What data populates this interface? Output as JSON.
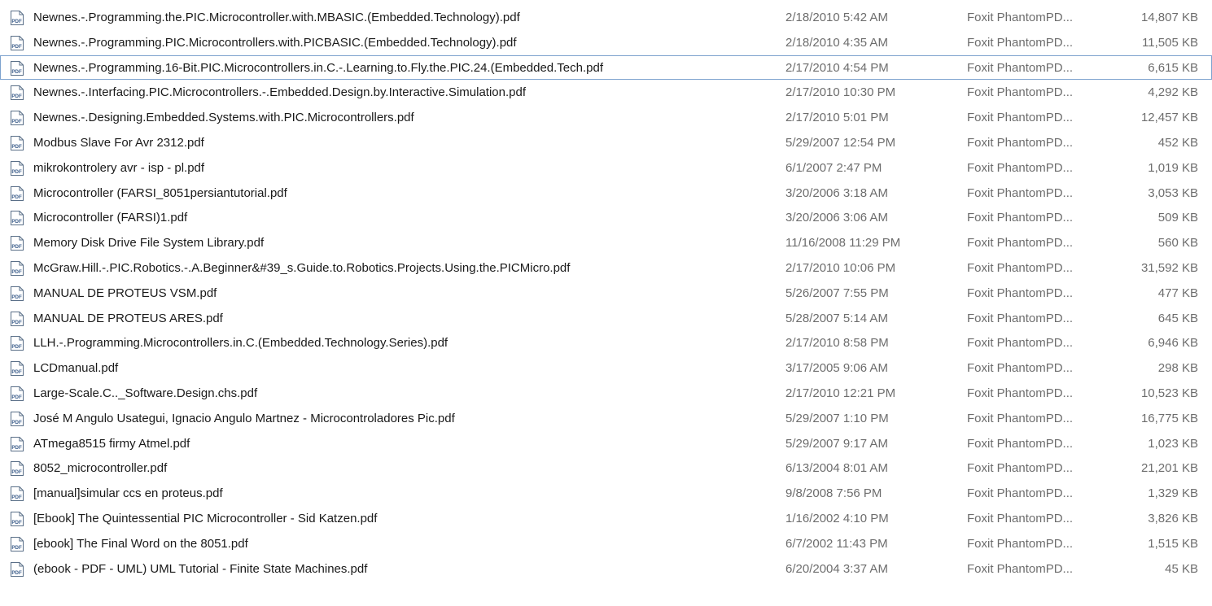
{
  "accent_color": "#7da2ce",
  "file_icon": "pdf-file-icon",
  "focused_index": 2,
  "files": [
    {
      "name": "Newnes.-.Programming.the.PIC.Microcontroller.with.MBASIC.(Embedded.Technology).pdf",
      "date": "2/18/2010 5:42 AM",
      "type": "Foxit PhantomPD...",
      "size": "14,807 KB"
    },
    {
      "name": "Newnes.-.Programming.PIC.Microcontrollers.with.PICBASIC.(Embedded.Technology).pdf",
      "date": "2/18/2010 4:35 AM",
      "type": "Foxit PhantomPD...",
      "size": "11,505 KB"
    },
    {
      "name": "Newnes.-.Programming.16-Bit.PIC.Microcontrollers.in.C.-.Learning.to.Fly.the.PIC.24.(Embedded.Tech.pdf",
      "date": "2/17/2010 4:54 PM",
      "type": "Foxit PhantomPD...",
      "size": "6,615 KB"
    },
    {
      "name": "Newnes.-.Interfacing.PIC.Microcontrollers.-.Embedded.Design.by.Interactive.Simulation.pdf",
      "date": "2/17/2010 10:30 PM",
      "type": "Foxit PhantomPD...",
      "size": "4,292 KB"
    },
    {
      "name": "Newnes.-.Designing.Embedded.Systems.with.PIC.Microcontrollers.pdf",
      "date": "2/17/2010 5:01 PM",
      "type": "Foxit PhantomPD...",
      "size": "12,457 KB"
    },
    {
      "name": "Modbus Slave For Avr 2312.pdf",
      "date": "5/29/2007 12:54 PM",
      "type": "Foxit PhantomPD...",
      "size": "452 KB"
    },
    {
      "name": "mikrokontrolery avr - isp - pl.pdf",
      "date": "6/1/2007 2:47 PM",
      "type": "Foxit PhantomPD...",
      "size": "1,019 KB"
    },
    {
      "name": "Microcontroller (FARSI_8051persiantutorial.pdf",
      "date": "3/20/2006 3:18 AM",
      "type": "Foxit PhantomPD...",
      "size": "3,053 KB"
    },
    {
      "name": "Microcontroller (FARSI)1.pdf",
      "date": "3/20/2006 3:06 AM",
      "type": "Foxit PhantomPD...",
      "size": "509 KB"
    },
    {
      "name": "Memory Disk Drive File System Library.pdf",
      "date": "11/16/2008 11:29 PM",
      "type": "Foxit PhantomPD...",
      "size": "560 KB"
    },
    {
      "name": "McGraw.Hill.-.PIC.Robotics.-.A.Beginner&#39_s.Guide.to.Robotics.Projects.Using.the.PICMicro.pdf",
      "date": "2/17/2010 10:06 PM",
      "type": "Foxit PhantomPD...",
      "size": "31,592 KB"
    },
    {
      "name": "MANUAL DE PROTEUS VSM.pdf",
      "date": "5/26/2007 7:55 PM",
      "type": "Foxit PhantomPD...",
      "size": "477 KB"
    },
    {
      "name": "MANUAL DE PROTEUS ARES.pdf",
      "date": "5/28/2007 5:14 AM",
      "type": "Foxit PhantomPD...",
      "size": "645 KB"
    },
    {
      "name": "LLH.-.Programming.Microcontrollers.in.C.(Embedded.Technology.Series).pdf",
      "date": "2/17/2010 8:58 PM",
      "type": "Foxit PhantomPD...",
      "size": "6,946 KB"
    },
    {
      "name": "LCDmanual.pdf",
      "date": "3/17/2005 9:06 AM",
      "type": "Foxit PhantomPD...",
      "size": "298 KB"
    },
    {
      "name": "Large-Scale.C.._Software.Design.chs.pdf",
      "date": "2/17/2010 12:21 PM",
      "type": "Foxit PhantomPD...",
      "size": "10,523 KB"
    },
    {
      "name": "José M Angulo Usategui, Ignacio Angulo Martnez - Microcontroladores Pic.pdf",
      "date": "5/29/2007 1:10 PM",
      "type": "Foxit PhantomPD...",
      "size": "16,775 KB"
    },
    {
      "name": "ATmega8515 firmy Atmel.pdf",
      "date": "5/29/2007 9:17 AM",
      "type": "Foxit PhantomPD...",
      "size": "1,023 KB"
    },
    {
      "name": "8052_microcontroller.pdf",
      "date": "6/13/2004 8:01 AM",
      "type": "Foxit PhantomPD...",
      "size": "21,201 KB"
    },
    {
      "name": "[manual]simular ccs en proteus.pdf",
      "date": "9/8/2008 7:56 PM",
      "type": "Foxit PhantomPD...",
      "size": "1,329 KB"
    },
    {
      "name": "[Ebook] The Quintessential PIC Microcontroller - Sid Katzen.pdf",
      "date": "1/16/2002 4:10 PM",
      "type": "Foxit PhantomPD...",
      "size": "3,826 KB"
    },
    {
      "name": "[ebook] The Final Word on the 8051.pdf",
      "date": "6/7/2002 11:43 PM",
      "type": "Foxit PhantomPD...",
      "size": "1,515 KB"
    },
    {
      "name": "(ebook - PDF - UML) UML Tutorial - Finite State Machines.pdf",
      "date": "6/20/2004 3:37 AM",
      "type": "Foxit PhantomPD...",
      "size": "45 KB"
    }
  ]
}
